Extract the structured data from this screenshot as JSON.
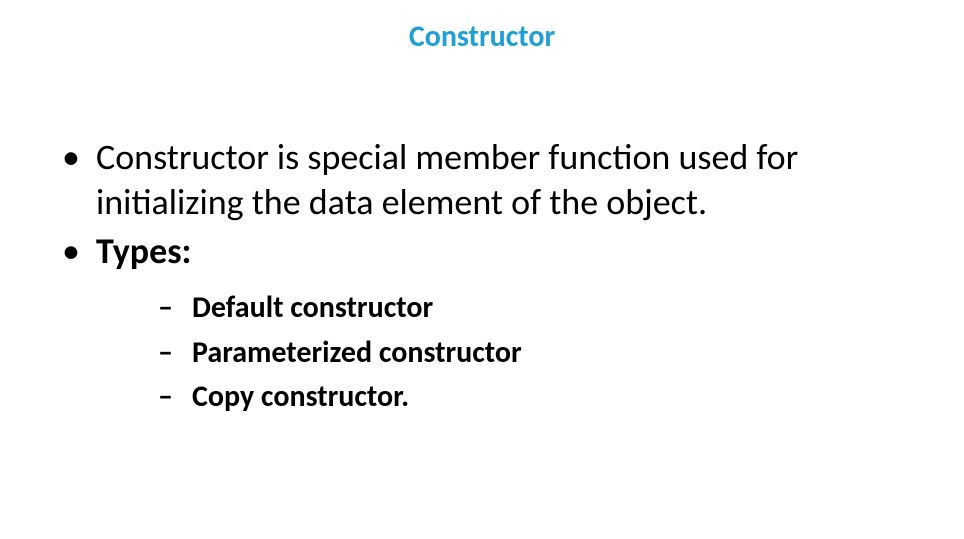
{
  "title": "Constructor",
  "bullets": {
    "b1": "Constructor is special member function used for initializing the data element of the object.",
    "b2": "Types:",
    "sub": {
      "s1": "Default constructor",
      "s2": "Parameterized constructor",
      "s3": "Copy constructor."
    }
  }
}
